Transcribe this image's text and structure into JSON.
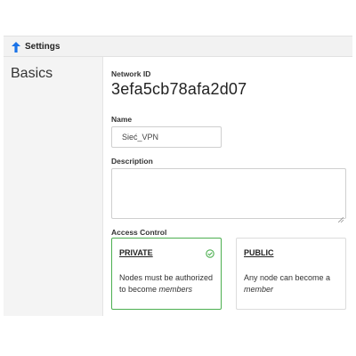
{
  "header": {
    "title": "Settings",
    "icon": "arrow-up-icon",
    "accent_color": "#1a73e8"
  },
  "sidebar": {
    "heading": "Basics"
  },
  "network": {
    "id_label": "Network ID",
    "id_value": "3efa5cb78afa2d07",
    "name_label": "Name",
    "name_value": "Sieć_VPN",
    "description_label": "Description",
    "description_value": ""
  },
  "access_control": {
    "label": "Access Control",
    "selected": "PRIVATE",
    "selected_color": "#4caf50",
    "options": [
      {
        "title": "PRIVATE",
        "desc_text": "Nodes must be authorized to become",
        "desc_em": "members",
        "icon": "check-circle-icon"
      },
      {
        "title": "PUBLIC",
        "desc_text": "Any node can become a",
        "desc_em": "member"
      }
    ]
  }
}
